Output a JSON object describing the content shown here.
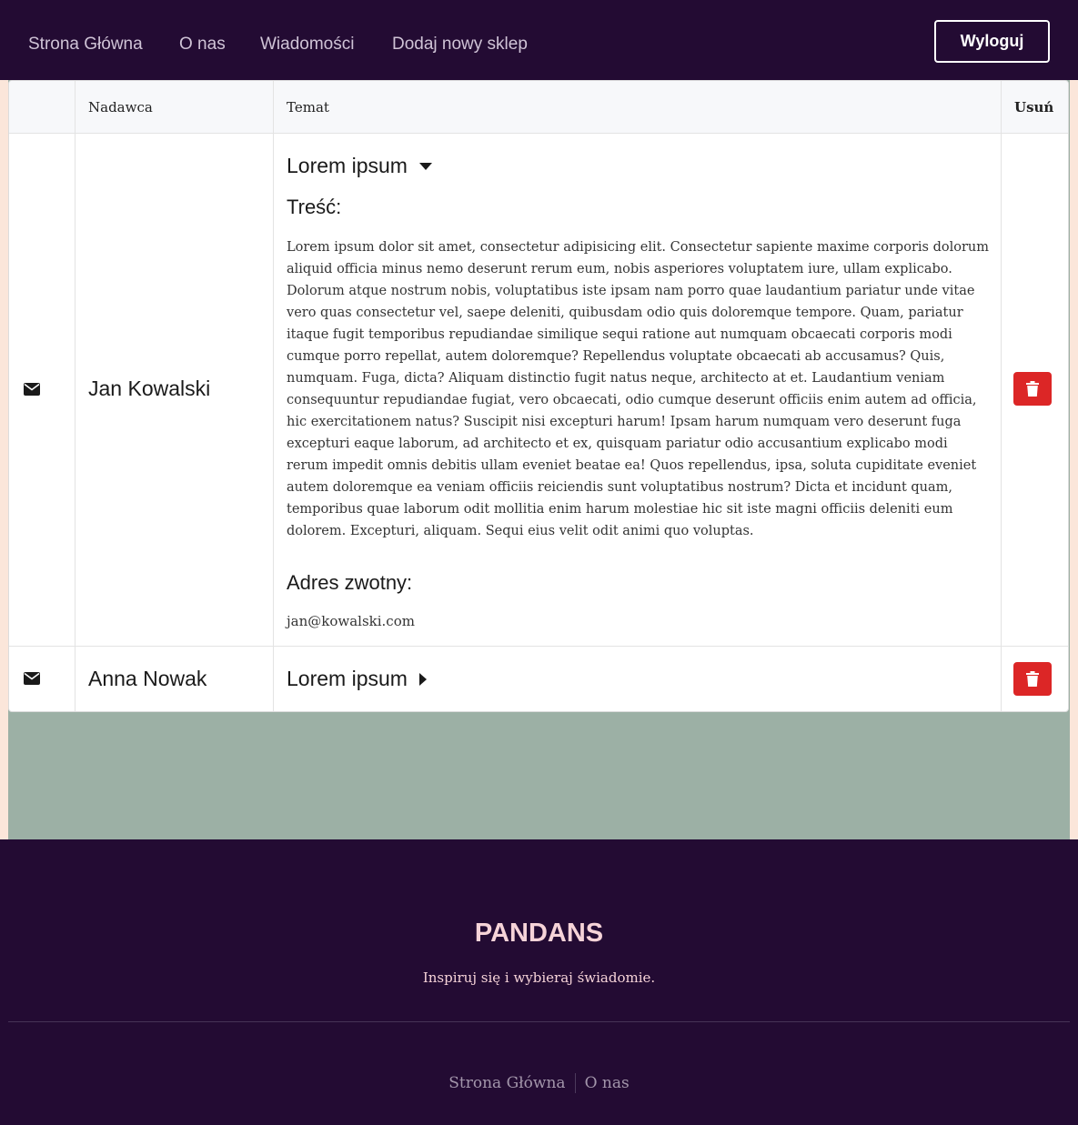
{
  "nav": {
    "links": [
      "Strona Główna",
      "O nas",
      "Wiadomości",
      "Dodaj nowy sklep"
    ],
    "logout_label": "Wyloguj"
  },
  "table": {
    "headers": {
      "icon": "",
      "sender": "Nadawca",
      "subject": "Temat",
      "delete": "Usuń"
    },
    "rows": [
      {
        "icon": "envelope-icon",
        "sender": "Jan Kowalski",
        "subject": "Lorem ipsum",
        "expanded": true,
        "content_label": "Treść:",
        "content": "Lorem ipsum dolor sit amet, consectetur adipisicing elit. Consectetur sapiente maxime corporis dolorum aliquid officia minus nemo deserunt rerum eum, nobis asperiores voluptatem iure, ullam explicabo. Dolorum atque nostrum nobis, voluptatibus iste ipsam nam porro quae laudantium pariatur unde vitae vero quas consectetur vel, saepe deleniti, quibusdam odio quis doloremque tempore. Quam, pariatur itaque fugit temporibus repudiandae similique sequi ratione aut numquam obcaecati corporis modi cumque porro repellat, autem doloremque? Repellendus voluptate obcaecati ab accusamus? Quis, numquam. Fuga, dicta? Aliquam distinctio fugit natus neque, architecto at et. Laudantium veniam consequuntur repudiandae fugiat, vero obcaecati, odio cumque deserunt officiis enim autem ad officia, hic exercitationem natus? Suscipit nisi excepturi harum! Ipsam harum numquam vero deserunt fuga excepturi eaque laborum, ad architecto et ex, quisquam pariatur odio accusantium explicabo modi rerum impedit omnis debitis ullam eveniet beatae ea! Quos repellendus, ipsa, soluta cupiditate eveniet autem doloremque ea veniam officiis reiciendis sunt voluptatibus nostrum? Dicta et incidunt quam, temporibus quae laborum odit mollitia enim harum molestiae hic sit iste magni officiis deleniti eum dolorem. Excepturi, aliquam. Sequi eius velit odit animi quo voluptas.",
        "reply_label": "Adres zwotny:",
        "reply_email": "jan@kowalski.com"
      },
      {
        "icon": "envelope-icon",
        "sender": "Anna Nowak",
        "subject": "Lorem ipsum",
        "expanded": false
      }
    ]
  },
  "footer": {
    "brand": "PANDANS",
    "tagline": "Inspiruj się i wybieraj świadomie.",
    "links": [
      "Strona Główna",
      "O nas"
    ]
  },
  "colors": {
    "navbar_bg": "#230b33",
    "page_bg": "#fbe6da",
    "main_bg": "#9cb0a5",
    "delete_button": "#dc2626",
    "brand_text": "#f6d3d8"
  }
}
